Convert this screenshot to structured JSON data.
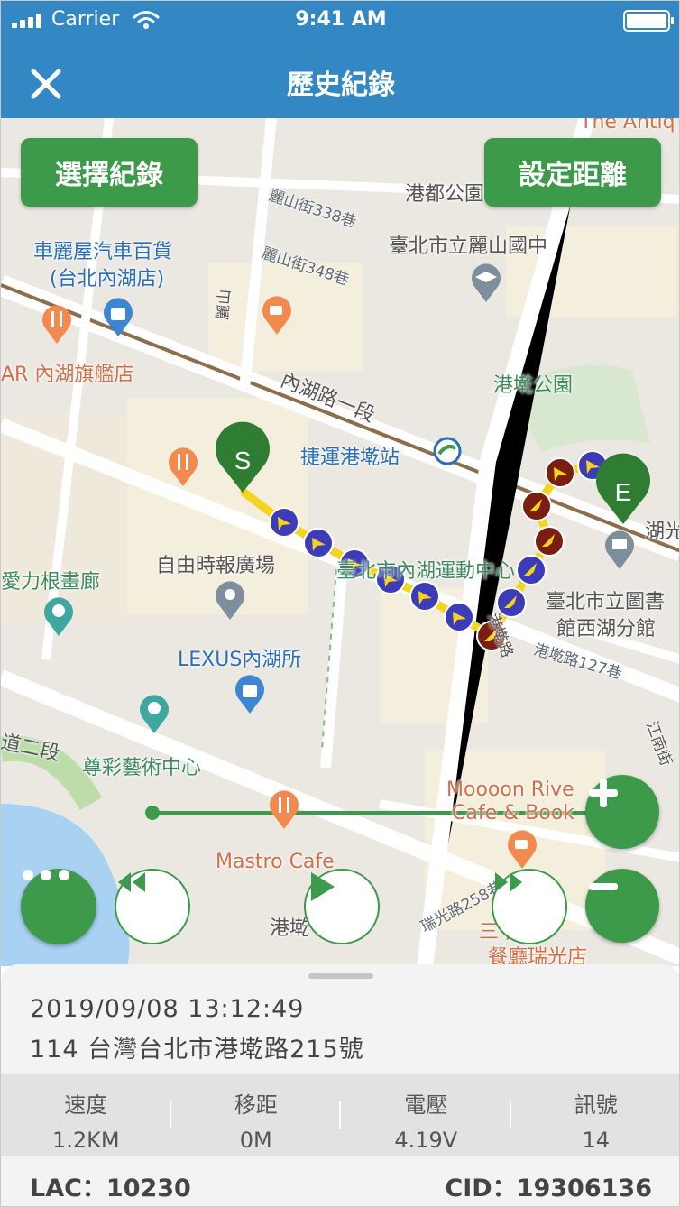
{
  "status_bar": {
    "carrier": "Carrier",
    "time": "9:41 AM"
  },
  "header": {
    "title": "歷史紀錄"
  },
  "buttons": {
    "select_record": "選擇紀錄",
    "set_distance": "設定距離"
  },
  "map": {
    "labels": {
      "gangdu_park": "港都公園",
      "library_school": "臺北市立麗山國中",
      "car_store_1": "車麗屋汽車百貨",
      "car_store_2": "(台北內湖店)",
      "flagship": "AR 內湖旗艦店",
      "gangqian_park": "港墘公園",
      "road_neihu": "內湖路一段",
      "mrt_station": "捷運港墘站",
      "liberty_square": "自由時報廣場",
      "sports_center": "臺北市內湖運動中心",
      "library_branch_1": "臺北市立圖書",
      "library_branch_2": "館西湖分館",
      "gallery": "愛力根畫廊",
      "lexus": "LEXUS內湖所",
      "art_center": "尊彩藝術中心",
      "cafe_1": "Moooon Rive",
      "cafe_2": "Cafe & Book",
      "mastro": "Mastro Cafe",
      "lishan_338": "麗山街338巷",
      "lishan_348": "麗山街348巷",
      "gangqian_127": "港墘路127巷",
      "ruiguang_258": "瑞光路258巷",
      "restaurant": "三 國韓",
      "restaurant_2": "餐廳瑞光店",
      "gangqian_road": "港墘路",
      "hu": "湖光",
      "gang": "港墘",
      "antiq": "The Antiq",
      "erduan": "道二段",
      "lishan": "麗山",
      "jiangnan": "江南街"
    },
    "markers": {
      "start": "S",
      "end": "E"
    }
  },
  "record": {
    "datetime": "2019/09/08 13:12:49",
    "address": "114 台灣台北市港墘路215號",
    "stats": [
      {
        "label": "速度",
        "value": "1.2KM"
      },
      {
        "label": "移距",
        "value": "0M"
      },
      {
        "label": "電壓",
        "value": "4.19V"
      },
      {
        "label": "訊號",
        "value": "14"
      }
    ],
    "lac": "LAC：10230",
    "cid": "CID：19306136"
  },
  "colors": {
    "header": "#3388c4",
    "accent_green": "#3e9a4b",
    "route": "#f2d51f",
    "arrow_blue": "#3c3cb8",
    "arrow_brown": "#7a1e10"
  }
}
